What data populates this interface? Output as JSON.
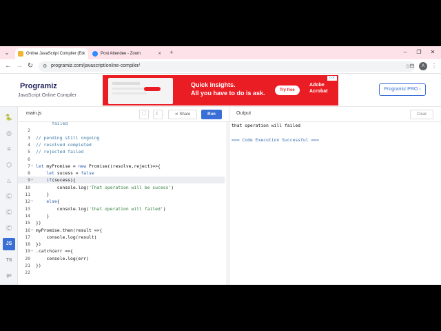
{
  "browser": {
    "tabs": [
      {
        "title": "Online JavaScript Compiler (Ed",
        "active": true
      },
      {
        "title": "Post Attendee - Zoom",
        "active": false
      }
    ],
    "url": "programiz.com/javascript/online-compiler/",
    "profile_initial": "A"
  },
  "site": {
    "logo_name": "Programiz",
    "logo_sub": "JavaScript Online Compiler",
    "pro_button": "Programiz PRO ›",
    "ad": {
      "headline_1": "Quick insights.",
      "headline_2": "All you have to do is ask.",
      "button": "Try free",
      "brand_1": "Adobe",
      "brand_2": "Acrobat"
    }
  },
  "sidebar": {
    "items": [
      "python",
      "r",
      "sql",
      "html",
      "java",
      "c",
      "cpp",
      "csharp",
      "JS",
      "TS",
      "go"
    ],
    "active": "JS"
  },
  "editor": {
    "file_name": "main.js",
    "share_label": "Share",
    "run_label": "Run",
    "lines": [
      {
        "n": "",
        "fold": "",
        "tokens": [
          {
            "t": "      failed",
            "c": "com"
          }
        ]
      },
      {
        "n": "2",
        "fold": "",
        "tokens": []
      },
      {
        "n": "3",
        "fold": "",
        "tokens": [
          {
            "t": "// pending still ongoing",
            "c": "com"
          }
        ]
      },
      {
        "n": "4",
        "fold": "",
        "tokens": [
          {
            "t": "// resolved completed",
            "c": "com"
          }
        ]
      },
      {
        "n": "5",
        "fold": "",
        "tokens": [
          {
            "t": "// rejected failed",
            "c": "com"
          }
        ]
      },
      {
        "n": "6",
        "fold": "",
        "tokens": []
      },
      {
        "n": "7",
        "fold": "▾",
        "tokens": [
          {
            "t": "let",
            "c": "kw"
          },
          {
            "t": " myPromise = ",
            "c": "plain"
          },
          {
            "t": "new",
            "c": "kw"
          },
          {
            "t": " Promise((resolve,reject)=>{",
            "c": "plain"
          }
        ]
      },
      {
        "n": "8",
        "fold": "",
        "tokens": [
          {
            "t": "    ",
            "c": "plain"
          },
          {
            "t": "let",
            "c": "kw"
          },
          {
            "t": " sucess = ",
            "c": "plain"
          },
          {
            "t": "false",
            "c": "kw"
          }
        ]
      },
      {
        "n": "9",
        "fold": "▾",
        "hl": true,
        "tokens": [
          {
            "t": "    ",
            "c": "plain"
          },
          {
            "t": "if",
            "c": "kw"
          },
          {
            "t": "(sucess){",
            "c": "plain"
          }
        ]
      },
      {
        "n": "10",
        "fold": "",
        "tokens": [
          {
            "t": "        console.log(",
            "c": "plain"
          },
          {
            "t": "'That operation will be sucess'",
            "c": "str"
          },
          {
            "t": ")",
            "c": "plain"
          }
        ]
      },
      {
        "n": "11",
        "fold": "",
        "tokens": [
          {
            "t": "    }",
            "c": "plain"
          }
        ]
      },
      {
        "n": "12",
        "fold": "▾",
        "tokens": [
          {
            "t": "    ",
            "c": "plain"
          },
          {
            "t": "else",
            "c": "kw"
          },
          {
            "t": "{",
            "c": "plain"
          }
        ]
      },
      {
        "n": "13",
        "fold": "",
        "tokens": [
          {
            "t": "        console.log(",
            "c": "plain"
          },
          {
            "t": "'that operation will failed'",
            "c": "str"
          },
          {
            "t": ")",
            "c": "plain"
          }
        ]
      },
      {
        "n": "14",
        "fold": "",
        "tokens": [
          {
            "t": "    }",
            "c": "plain"
          }
        ]
      },
      {
        "n": "15",
        "fold": "",
        "tokens": [
          {
            "t": "})",
            "c": "plain"
          }
        ]
      },
      {
        "n": "16",
        "fold": "▾",
        "tokens": [
          {
            "t": "myPromise.then(result =>{",
            "c": "plain"
          }
        ]
      },
      {
        "n": "17",
        "fold": "",
        "tokens": [
          {
            "t": "    console.log(result)",
            "c": "plain"
          }
        ]
      },
      {
        "n": "18",
        "fold": "",
        "tokens": [
          {
            "t": "})",
            "c": "plain"
          }
        ]
      },
      {
        "n": "19",
        "fold": "▾",
        "tokens": [
          {
            "t": ".catch(err =>{",
            "c": "plain"
          }
        ]
      },
      {
        "n": "20",
        "fold": "",
        "tokens": [
          {
            "t": "    console.log(err)",
            "c": "plain"
          }
        ]
      },
      {
        "n": "21",
        "fold": "",
        "tokens": [
          {
            "t": "})",
            "c": "plain"
          }
        ]
      },
      {
        "n": "22",
        "fold": "",
        "tokens": []
      }
    ]
  },
  "output": {
    "title": "Output",
    "clear_label": "Clear",
    "line_1": "that operation will failed",
    "line_2": "=== Code Execution Successful ==="
  },
  "colors": {
    "accent": "#3b6fd8",
    "tab_strip": "#fde3e9",
    "ad_red": "#eb1d24"
  }
}
